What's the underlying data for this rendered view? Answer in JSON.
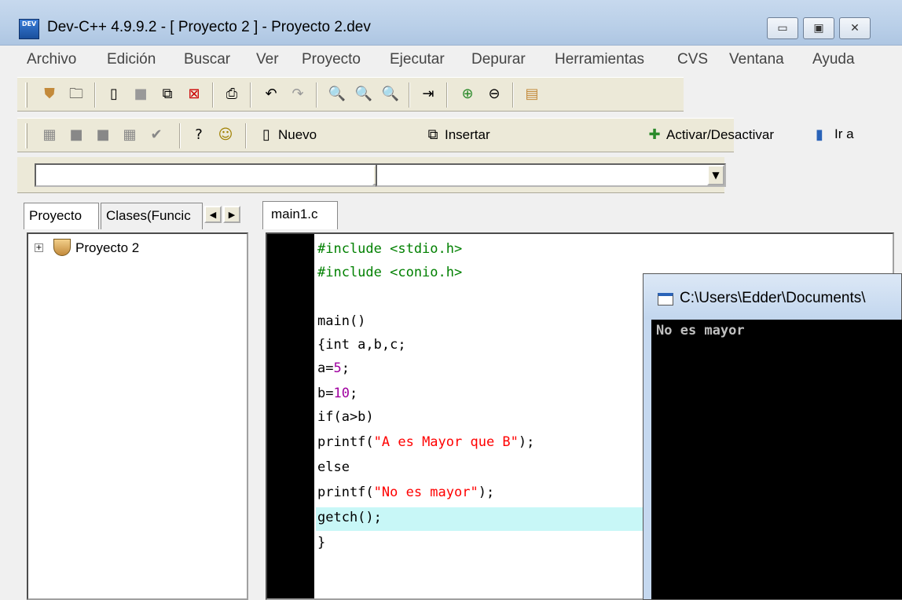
{
  "window": {
    "title": "Dev-C++ 4.9.9.2  - [ Proyecto 2 ] - Proyecto 2.dev",
    "logo": "DEV",
    "controls": [
      "minimize-icon",
      "maximize-icon",
      "close-icon"
    ]
  },
  "menu": {
    "items": [
      "Archivo",
      "Edición",
      "Buscar",
      "Ver",
      "Proyecto",
      "Ejecutar",
      "Depurar",
      "Herramientas",
      "CVS",
      "Ventana",
      "Ayuda"
    ]
  },
  "toolbar2": {
    "nuevo": "Nuevo",
    "insertar": "Insertar",
    "activar": "Activar/Desactivar",
    "ir_a": "Ir a"
  },
  "left_panel": {
    "tabs": [
      "Proyecto",
      "Clases(Funcic"
    ],
    "tree_root": "Proyecto 2"
  },
  "editor": {
    "tab": "main1.c",
    "lines": [
      {
        "text": "#include <stdio.h>",
        "color": "#008000"
      },
      {
        "text": "#include <conio.h>",
        "color": "#008000"
      },
      {
        "text": "",
        "color": "#000000"
      },
      {
        "text": "main()",
        "color": "#000000"
      },
      {
        "text": "{int a,b,c;",
        "color": "#000000"
      },
      {
        "text": "a=5;",
        "color": "#000000"
      },
      {
        "text": "b=10;",
        "color": "#000000"
      },
      {
        "text": "if(a>b)",
        "color": "#000000"
      },
      {
        "text": "printf(\"A es Mayor que B\");",
        "color": "#000000"
      },
      {
        "text": "else",
        "color": "#000000"
      },
      {
        "text": "printf(\"No es mayor\");",
        "color": "#000000"
      },
      {
        "text": "getch();",
        "color": "#000000"
      },
      {
        "text": "}",
        "color": "#000000"
      }
    ],
    "highlighted_line": 12
  },
  "console": {
    "title": "C:\\Users\\Edder\\Documents\\",
    "output": "No es mayor"
  },
  "colors": {
    "include": "#008000",
    "number": "#a000a0",
    "string": "#ff0000",
    "highlight": "#c8f7f7"
  }
}
